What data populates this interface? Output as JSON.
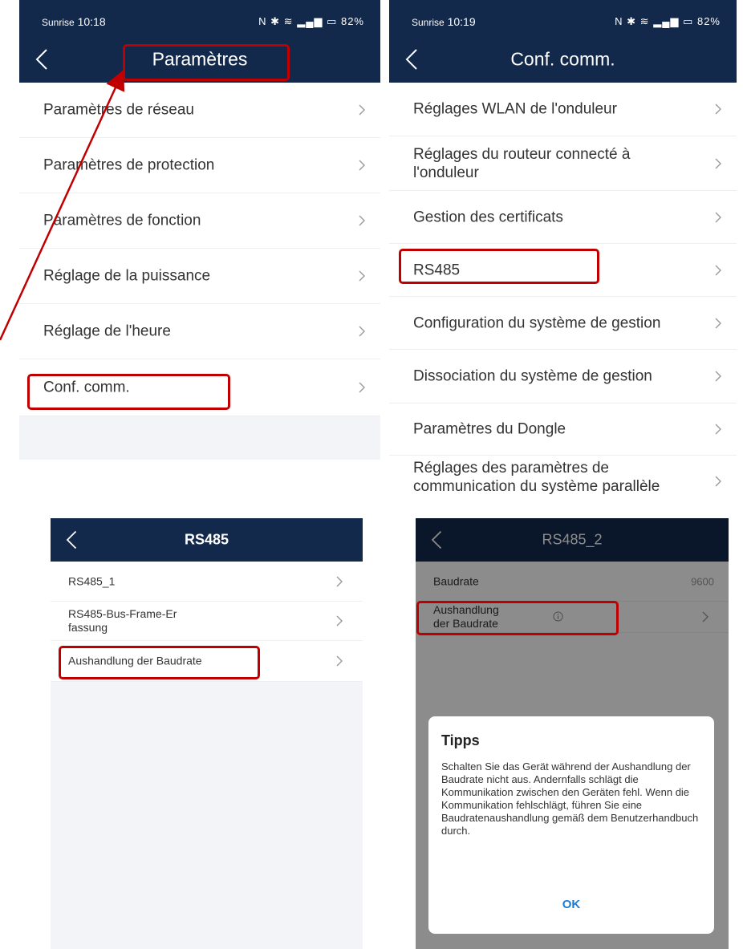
{
  "panel1": {
    "status": {
      "brand": "Sunrise",
      "time": "10:18",
      "battery": "82%"
    },
    "title": "Paramètres",
    "items": [
      {
        "label": "Paramètres de réseau"
      },
      {
        "label": "Paramètres de protection"
      },
      {
        "label": "Paramètres de fonction"
      },
      {
        "label": "Réglage de la puissance"
      },
      {
        "label": "Réglage de l'heure"
      },
      {
        "label": "Conf. comm."
      }
    ]
  },
  "panel2": {
    "status": {
      "brand": "Sunrise",
      "time": "10:19",
      "battery": "82%"
    },
    "title": "Conf. comm.",
    "items": [
      {
        "label": "Réglages WLAN de l'onduleur"
      },
      {
        "label": "Réglages du routeur connecté à l'onduleur"
      },
      {
        "label": "Gestion des certificats"
      },
      {
        "label": "RS485"
      },
      {
        "label": "Configuration du système de gestion"
      },
      {
        "label": "Dissociation du système de gestion"
      },
      {
        "label": "Paramètres du Dongle"
      },
      {
        "label": "Réglages des paramètres de communication du système parallèle"
      }
    ]
  },
  "panel3": {
    "title": "RS485",
    "items": [
      {
        "label": "RS485_1"
      },
      {
        "label": "RS485-Bus-Frame-Er fassung"
      },
      {
        "label": "Aushandlung der Baudrate"
      }
    ]
  },
  "panel4": {
    "title": "RS485_2",
    "baudrate_label": "Baudrate",
    "baudrate_value": "9600",
    "negotiation_label": "Aushandlung der Baudrate",
    "dialog": {
      "title": "Tipps",
      "body": "Schalten Sie das Gerät während der Aushandlung der Baudrate nicht aus. Andernfalls schlägt die Kommunikation zwischen den Geräten fehl. Wenn die Kommunikation fehlschlägt, führen Sie eine Baudratenaushandlung gemäß dem Benutzerhandbuch durch.",
      "ok": "OK"
    }
  },
  "colors": {
    "navbar": "#13294b",
    "highlight": "#c00000",
    "dialog_button": "#1b7cd6"
  }
}
